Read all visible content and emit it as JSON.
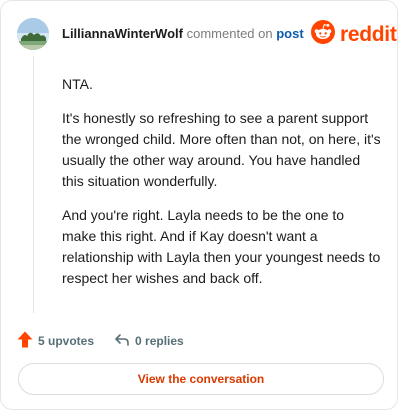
{
  "header": {
    "username": "LilliannaWinterWolf",
    "commented_text": "commented on",
    "post_link": "post",
    "logo_text": "reddit"
  },
  "comment": {
    "paragraphs": [
      "NTA.",
      "It's honestly so refreshing to see a parent support the wronged child. More often than not, on here, it's usually the other way around. You have handled this situation wonderfully.",
      "And you're right. Layla needs to be the one to make this right. And if Kay doesn't want a relationship with Layla then your youngest needs to respect her wishes and back off."
    ]
  },
  "actions": {
    "upvotes_label": "5 upvotes",
    "replies_label": "0 replies"
  },
  "cta": {
    "label": "View the conversation"
  },
  "colors": {
    "brand": "#ff4500",
    "link": "#0b5cad",
    "cta_text": "#d93a00"
  },
  "icons": [
    "user-avatar",
    "reddit-snoo-icon",
    "upvote-arrow-icon",
    "reply-arrow-icon"
  ]
}
